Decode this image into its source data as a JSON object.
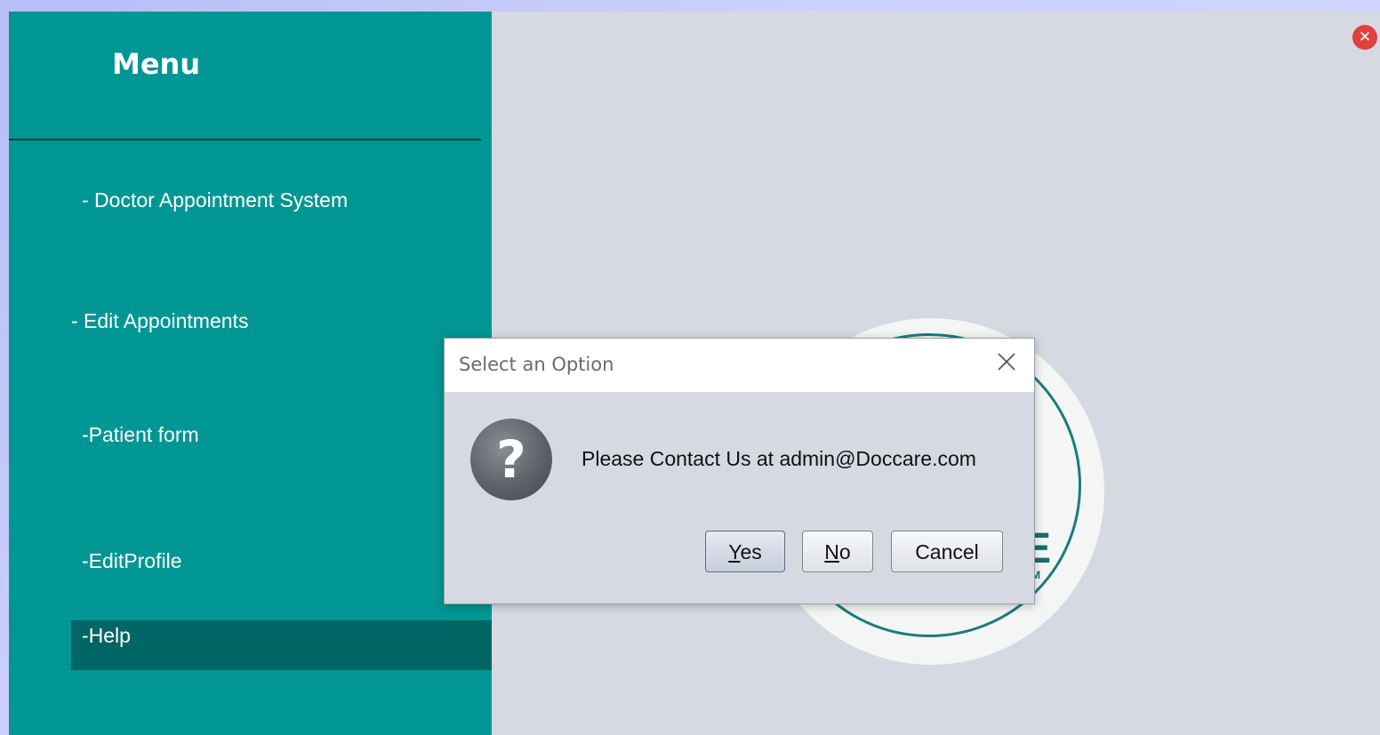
{
  "sidebar": {
    "title": "Menu",
    "items": [
      {
        "label": "- Doctor Appointment System"
      },
      {
        "label": "- Edit Appointments"
      },
      {
        "label": "-Patient form"
      },
      {
        "label": "-EditProfile"
      },
      {
        "label": "-Help",
        "active": true
      }
    ]
  },
  "logo": {
    "letter": "E",
    "letter_small": "M"
  },
  "dialog": {
    "title": "Select an Option",
    "message": "Please Contact Us at admin@Doccare.com",
    "icon": "question-icon",
    "buttons": {
      "yes": {
        "mnemonic": "Y",
        "rest": "es"
      },
      "no": {
        "mnemonic": "N",
        "rest": "o"
      },
      "cancel": "Cancel"
    }
  },
  "window": {
    "close_icon": "close-icon"
  },
  "colors": {
    "sidebar": "#009694",
    "sidebar_active": "#006665",
    "content_bg": "#d6d9e1",
    "logo_ring": "#1a7d7a",
    "close_button": "#e0413c"
  }
}
